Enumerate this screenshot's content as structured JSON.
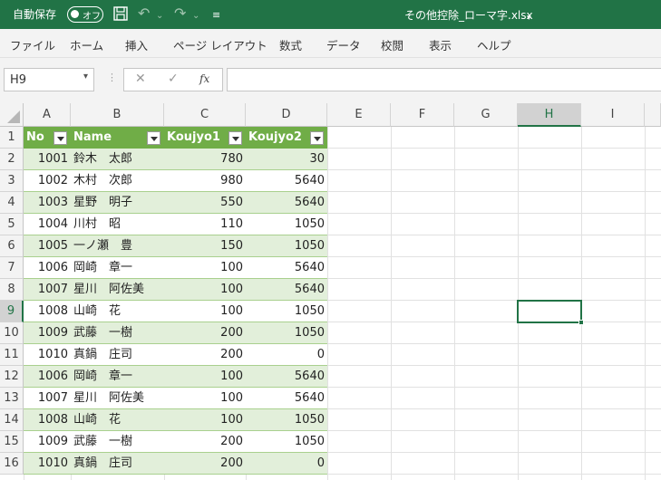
{
  "titlebar": {
    "autosave_label": "自動保存",
    "autosave_state": "オフ",
    "filename": "その他控除_ローマ字.xlsx"
  },
  "ribbon": {
    "tabs": [
      "ファイル",
      "ホーム",
      "挿入",
      "ページ レイアウト",
      "数式",
      "データ",
      "校閲",
      "表示",
      "ヘルプ"
    ]
  },
  "formula_bar": {
    "name_box": "H9",
    "fx_label": "fx",
    "formula": ""
  },
  "columns": [
    "A",
    "B",
    "C",
    "D",
    "E",
    "F",
    "G",
    "H",
    "I"
  ],
  "selected_cell": {
    "column": "H",
    "row": "9"
  },
  "table": {
    "headers": [
      "No",
      "Name",
      "Koujyo1",
      "Koujyo2"
    ],
    "rows": [
      [
        "1001",
        "鈴木　太郎",
        "780",
        "30"
      ],
      [
        "1002",
        "木村　次郎",
        "980",
        "5640"
      ],
      [
        "1003",
        "星野　明子",
        "550",
        "5640"
      ],
      [
        "1004",
        "川村　昭",
        "110",
        "1050"
      ],
      [
        "1005",
        "一ノ瀬　豊",
        "150",
        "1050"
      ],
      [
        "1006",
        "岡崎　章一",
        "100",
        "5640"
      ],
      [
        "1007",
        "星川　阿佐美",
        "100",
        "5640"
      ],
      [
        "1008",
        "山崎　花",
        "100",
        "1050"
      ],
      [
        "1009",
        "武藤　一樹",
        "200",
        "1050"
      ],
      [
        "1010",
        "真鍋　庄司",
        "200",
        "0"
      ],
      [
        "1006",
        "岡崎　章一",
        "100",
        "5640"
      ],
      [
        "1007",
        "星川　阿佐美",
        "100",
        "5640"
      ],
      [
        "1008",
        "山崎　花",
        "100",
        "1050"
      ],
      [
        "1009",
        "武藤　一樹",
        "200",
        "1050"
      ],
      [
        "1010",
        "真鍋　庄司",
        "200",
        "0"
      ]
    ]
  },
  "colors": {
    "excel_green": "#217346",
    "table_header": "#70ad47",
    "table_band": "#e2efda"
  }
}
